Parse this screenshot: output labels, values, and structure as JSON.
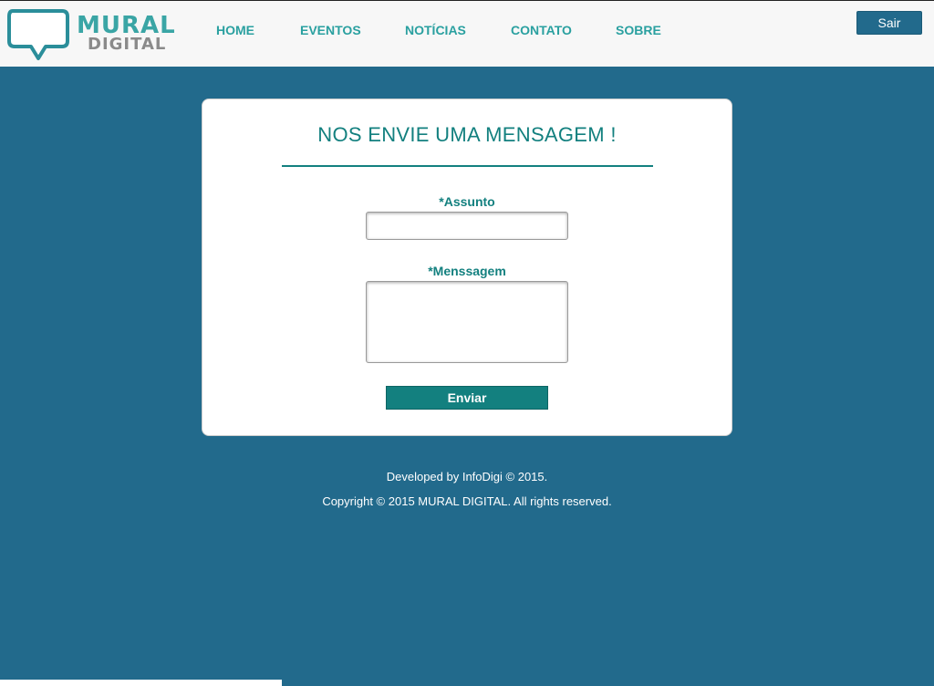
{
  "header": {
    "logo": {
      "line1": "MURAL",
      "line2": "DIGITAL"
    },
    "nav": [
      {
        "label": "HOME"
      },
      {
        "label": "EVENTOS"
      },
      {
        "label": "NOTÍCIAS"
      },
      {
        "label": "CONTATO"
      },
      {
        "label": "SOBRE"
      }
    ],
    "logout_label": "Sair"
  },
  "form": {
    "title": "NOS ENVIE UMA MENSAGEM !",
    "subject_label": "*Assunto",
    "subject_value": "",
    "message_label": "*Menssagem",
    "message_value": "",
    "submit_label": "Enviar"
  },
  "footer": {
    "line1": "Developed by InfoDigi © 2015.",
    "line2": "Copyright © 2015 MURAL DIGITAL. All rights reserved."
  },
  "colors": {
    "background": "#226a8c",
    "accent": "#13807f",
    "nav_text": "#2aa0a0",
    "header_bg": "#f7f7f7"
  }
}
